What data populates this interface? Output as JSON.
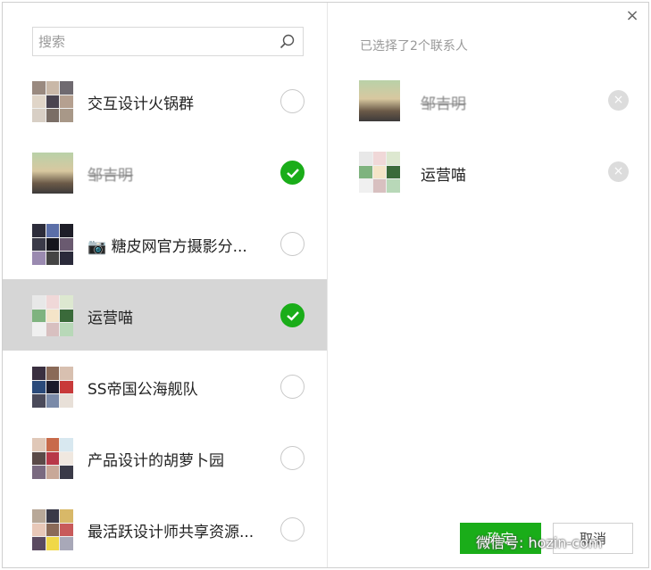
{
  "search": {
    "placeholder": "搜索"
  },
  "contacts": [
    {
      "name": "交互设计火锅群",
      "checked": false,
      "avatar_icon": "group-avatar-icon"
    },
    {
      "name": "邹吉明",
      "checked": true,
      "avatar_icon": "person-avatar-icon"
    },
    {
      "name": "📷 糖皮网官方摄影分...",
      "checked": false,
      "avatar_icon": "group-avatar-icon"
    },
    {
      "name": "运营喵",
      "checked": true,
      "avatar_icon": "group-avatar-icon"
    },
    {
      "name": "SS帝国公海舰队",
      "checked": false,
      "avatar_icon": "group-avatar-icon"
    },
    {
      "name": "产品设计的胡萝卜园",
      "checked": false,
      "avatar_icon": "group-avatar-icon"
    },
    {
      "name": "最活跃设计师共享资源...",
      "checked": false,
      "avatar_icon": "group-avatar-icon"
    }
  ],
  "selected": {
    "title": "已选择了2个联系人",
    "items": [
      {
        "name": "邹吉明"
      },
      {
        "name": "运营喵"
      }
    ]
  },
  "buttons": {
    "ok": "确定",
    "cancel": "取消"
  },
  "watermark": "微信号: hozin-com",
  "colors": {
    "accent": "#1aad19",
    "active_row": "#d6d6d6"
  }
}
